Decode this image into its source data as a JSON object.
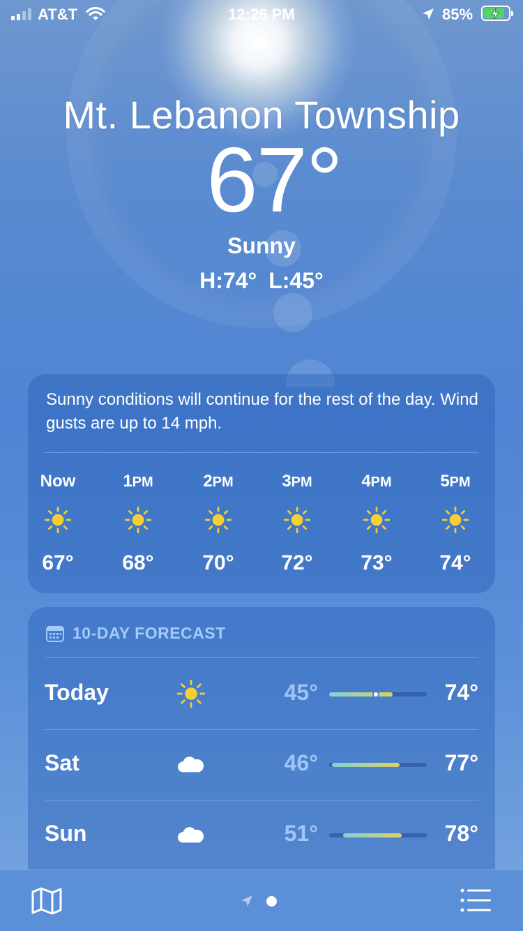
{
  "status_bar": {
    "carrier": "AT&T",
    "time": "12:26 PM",
    "battery": "85%",
    "battery_level": 0.85
  },
  "header": {
    "location": "Mt. Lebanon Township",
    "temperature": "67°",
    "condition": "Sunny",
    "high_low": "H:74°  L:45°"
  },
  "hourly": {
    "summary": "Sunny conditions will continue for the rest of the day. Wind gusts are up to 14 mph.",
    "hours": [
      {
        "time": "Now",
        "ampm": "",
        "icon": "sun-icon",
        "temp": "67°"
      },
      {
        "time": "1",
        "ampm": "PM",
        "icon": "sun-icon",
        "temp": "68°"
      },
      {
        "time": "2",
        "ampm": "PM",
        "icon": "sun-icon",
        "temp": "70°"
      },
      {
        "time": "3",
        "ampm": "PM",
        "icon": "sun-icon",
        "temp": "72°"
      },
      {
        "time": "4",
        "ampm": "PM",
        "icon": "sun-icon",
        "temp": "73°"
      },
      {
        "time": "5",
        "ampm": "PM",
        "icon": "sun-icon",
        "temp": "74°"
      }
    ]
  },
  "forecast": {
    "title": "10-DAY FORECAST",
    "icon": "calendar-icon",
    "days": [
      {
        "day": "Today",
        "icon": "sun-icon",
        "low": "45°",
        "high": "74°",
        "range_start": 0.0,
        "range_end": 0.65,
        "current": 0.48
      },
      {
        "day": "Sat",
        "icon": "cloud-icon",
        "low": "46°",
        "high": "77°",
        "range_start": 0.03,
        "range_end": 0.72
      },
      {
        "day": "Sun",
        "icon": "cloud-icon",
        "low": "51°",
        "high": "78°",
        "range_start": 0.14,
        "range_end": 0.74
      }
    ]
  },
  "colors": {
    "sun": "#f5cf34",
    "battery_fill": "#4cd964",
    "range_cool": "#7fd3d8",
    "range_warm": "#e0d160"
  },
  "toolbar": {
    "left_icon": "map-icon",
    "center_icon": "location-arrow-icon",
    "right_icon": "list-icon"
  }
}
